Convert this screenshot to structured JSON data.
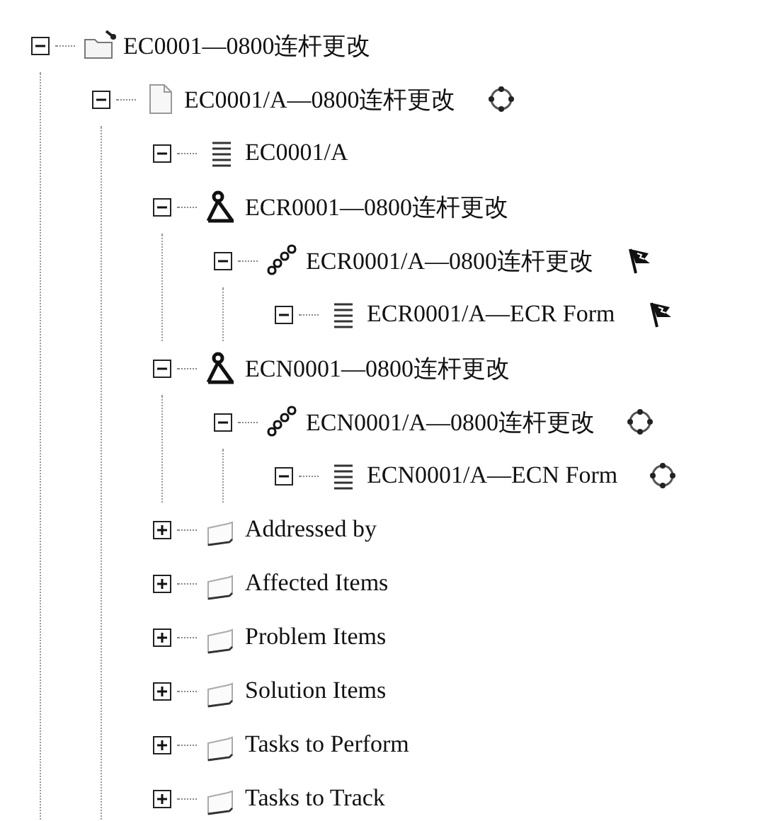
{
  "tree": [
    {
      "label": "EC0001—0800连杆更改",
      "kind": "change-folder",
      "expanded": true,
      "children": [
        {
          "label": "EC0001/A—0800连杆更改",
          "kind": "document",
          "status": {
            "kind": "circle"
          },
          "expanded": true,
          "children": [
            {
              "label": "EC0001/A",
              "kind": "lines",
              "expanded": true
            },
            {
              "label": "ECR0001—0800连杆更改",
              "kind": "compass",
              "expanded": true,
              "children": [
                {
                  "label": "ECR0001/A—0800连杆更改",
                  "kind": "chain",
                  "status": {
                    "kind": "flag"
                  },
                  "expanded": true,
                  "children": [
                    {
                      "label": "ECR0001/A—ECR Form",
                      "kind": "lines",
                      "status": {
                        "kind": "flag"
                      },
                      "expanded": true
                    }
                  ]
                }
              ]
            },
            {
              "label": "ECN0001—0800连杆更改",
              "kind": "compass",
              "expanded": true,
              "children": [
                {
                  "label": "ECN0001/A—0800连杆更改",
                  "kind": "chain",
                  "status": {
                    "kind": "circle"
                  },
                  "expanded": true,
                  "children": [
                    {
                      "label": "ECN0001/A—ECN Form",
                      "kind": "lines",
                      "status": {
                        "kind": "circle"
                      },
                      "expanded": true
                    }
                  ]
                }
              ]
            },
            {
              "label": "Addressed by",
              "kind": "folder",
              "expanded": false
            },
            {
              "label": "Affected Items",
              "kind": "folder",
              "expanded": false
            },
            {
              "label": "Problem Items",
              "kind": "folder",
              "expanded": false
            },
            {
              "label": "Solution Items",
              "kind": "folder",
              "expanded": false
            },
            {
              "label": "Tasks to Perform",
              "kind": "folder",
              "expanded": false
            },
            {
              "label": "Tasks to Track",
              "kind": "folder",
              "expanded": false
            }
          ]
        }
      ]
    }
  ]
}
